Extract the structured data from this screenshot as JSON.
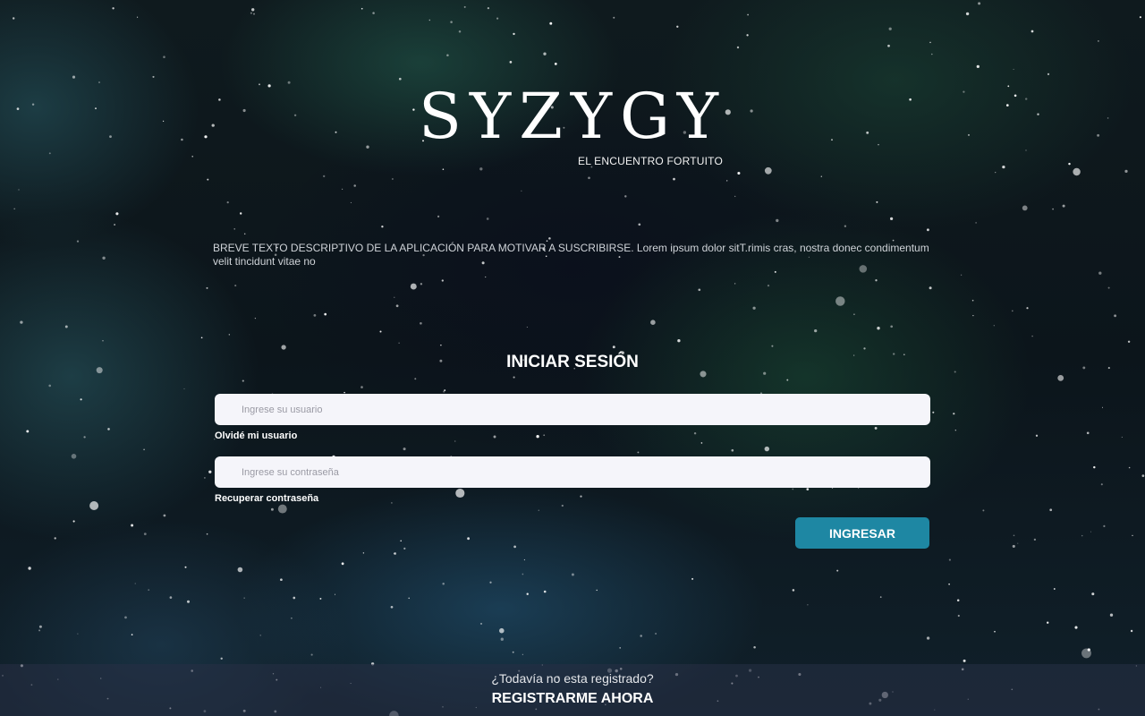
{
  "brand": {
    "logo": "SYZYGY",
    "tagline": "EL ENCUENTRO FORTUITO"
  },
  "intro": {
    "description": "BREVE TEXTO DESCRIPTIVO DE LA APLICACIÓN PARA MOTIVAR A SUSCRIBIRSE. Lorem ipsum dolor sitT.rimis cras, nostra donec condimentum velit tincidunt vitae no"
  },
  "login": {
    "title": "INICIAR SESIÓN",
    "username": {
      "value": "",
      "placeholder": "Ingrese su usuario"
    },
    "forgot_username": "Olvidé mi usuario",
    "password": {
      "value": "",
      "placeholder": "Ingrese su contraseña"
    },
    "recover_password": "Recuperar contraseña",
    "submit_label": "INGRESAR"
  },
  "footer": {
    "question": "¿Todavía no esta registrado?",
    "register_label": "REGISTRARME AHORA"
  },
  "colors": {
    "accent": "#1e87a3",
    "input_bg": "#f5f5fa",
    "background": "#0d1519"
  }
}
